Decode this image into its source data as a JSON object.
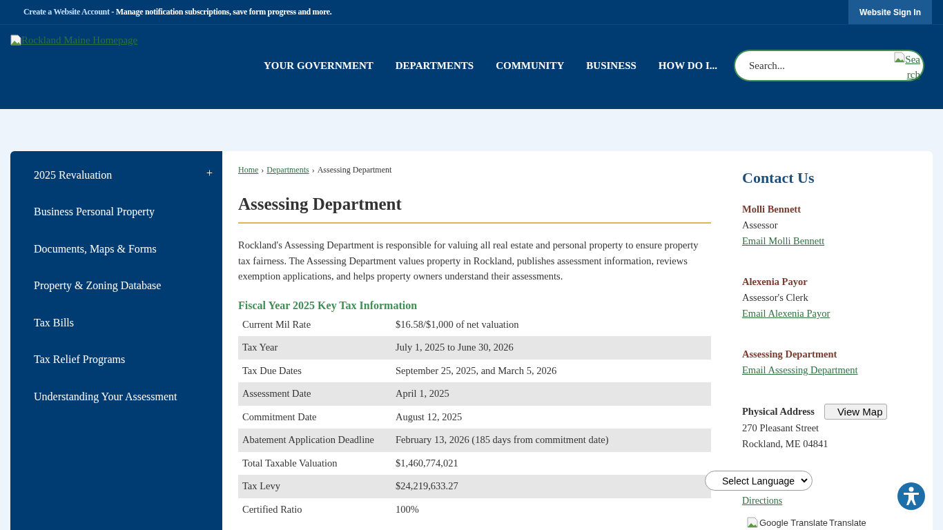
{
  "top_bar": {
    "account_link": "Create a Website Account",
    "account_text": " - Manage notification subscriptions, save form progress and more.",
    "sign_in": "Website Sign In"
  },
  "header": {
    "logo_alt": "Rockland Maine Homepage",
    "nav": [
      "YOUR GOVERNMENT",
      "DEPARTMENTS",
      "COMMUNITY",
      "BUSINESS",
      "HOW DO I..."
    ],
    "search": {
      "placeholder": "Search...",
      "button_alt_1": "Sea",
      "button_alt_2": "rch"
    }
  },
  "sidebar": {
    "items": [
      {
        "label": "2025 Revaluation",
        "expand_icon": "+"
      },
      {
        "label": "Business Personal Property"
      },
      {
        "label": "Documents, Maps & Forms"
      },
      {
        "label": "Property & Zoning Database"
      },
      {
        "label": "Tax Bills"
      },
      {
        "label": "Tax Relief Programs"
      },
      {
        "label": "Understanding Your Assessment"
      }
    ]
  },
  "breadcrumb": [
    {
      "label": "Home",
      "kind": "link"
    },
    {
      "label": "›",
      "kind": "separator"
    },
    {
      "label": "Departments",
      "kind": "link"
    },
    {
      "label": "›",
      "kind": "separator"
    },
    {
      "label": "Assessing Department",
      "kind": "current"
    }
  ],
  "title": "Assessing Department",
  "intro": "Rockland's Assessing Department is responsible for valuing all real estate and personal property to ensure property tax fairness. The Assessing Department values property in Rockland, publishes assessment information, reviews exemption applications, and helps property owners understand their assessments.",
  "tax_info": {
    "heading": "Fiscal Year 2025 Key Tax Information",
    "rows": [
      [
        "Current Mil Rate",
        "$16.58/$1,000 of net valuation"
      ],
      [
        "Tax Year",
        "July 1, 2025 to June 30, 2026"
      ],
      [
        "Tax Due Dates",
        "September 25, 2025, and March 5, 2026"
      ],
      [
        "Assessment Date",
        "April 1, 2025"
      ],
      [
        "Commitment Date",
        "August 12, 2025"
      ],
      [
        "Abatement Application Deadline",
        "February 13, 2026 (185 days from commitment date)"
      ],
      [
        "Total Taxable Valuation",
        "$1,460,774,021"
      ],
      [
        "Tax Levy",
        "$24,219,633.27"
      ],
      [
        "Certified Ratio",
        "100%"
      ]
    ]
  },
  "contact": {
    "heading": "Contact Us",
    "people": [
      {
        "name": "Molli Bennett",
        "role": "Assessor",
        "email": "Email Molli Bennett"
      },
      {
        "name": "Alexenia Payor",
        "role": "Assessor's Clerk",
        "email": "Email Alexenia Payor"
      },
      {
        "name": "Assessing Department",
        "email": "Email Assessing Department"
      }
    ],
    "address_label": "Physical Address",
    "view_map": "View Map",
    "address": [
      "270 Pleasant Street",
      "Rockland, ME 04841"
    ],
    "directions": "Directions"
  },
  "translate": {
    "select": "Select Language",
    "logo_alt": "Google Translate",
    "label": "Translate"
  }
}
